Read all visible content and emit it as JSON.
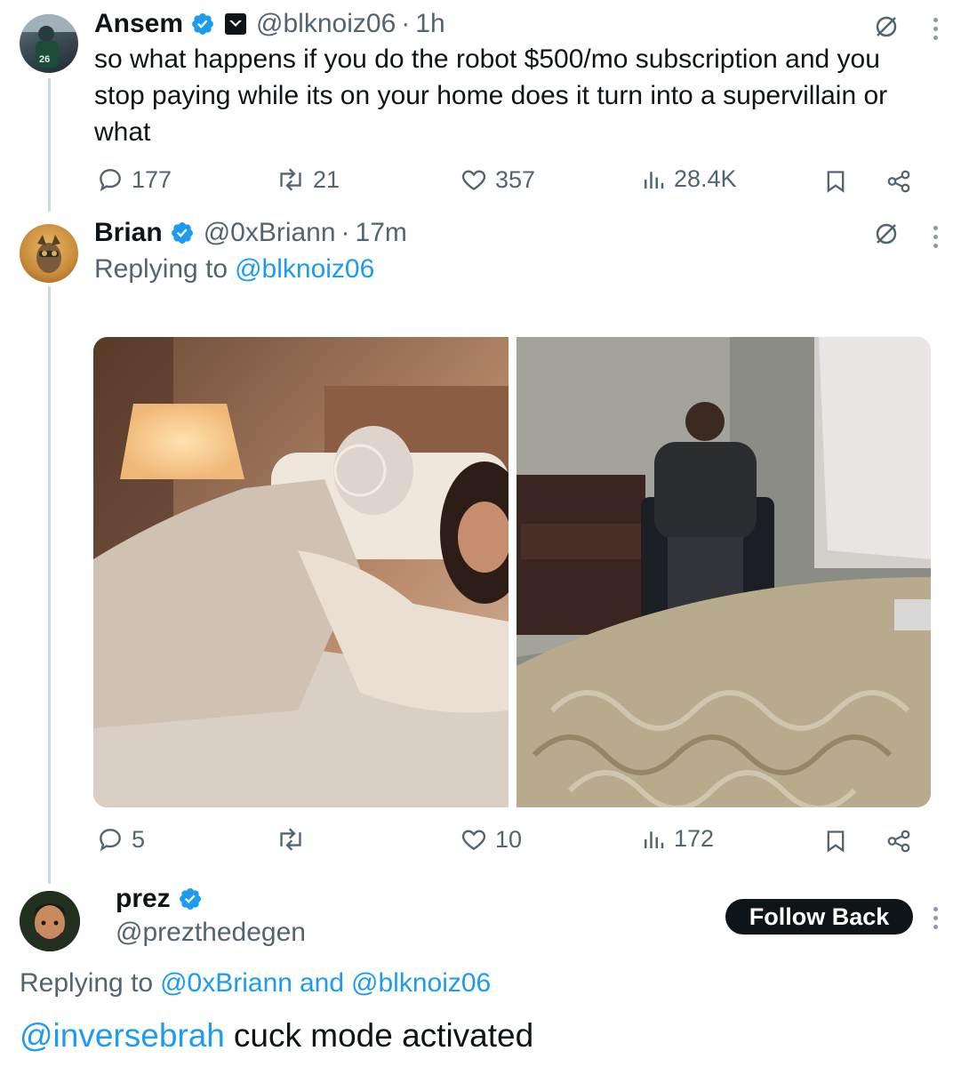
{
  "tweet1": {
    "name": "Ansem",
    "handle": "@blknoiz06",
    "time": "1h",
    "text": "so what happens if you do the robot $500/mo subscription and you stop paying while its on your home does it turn into a supervillain or what",
    "stats": {
      "replies": "177",
      "retweets": "21",
      "likes": "357",
      "views": "28.4K"
    }
  },
  "tweet2": {
    "name": "Brian",
    "handle": "@0xBriann",
    "time": "17m",
    "replying_prefix": "Replying to",
    "replying_to": "@blknoiz06",
    "images": [
      {
        "icon": "photo-robot-bedroom"
      },
      {
        "icon": "photo-man-in-chair-hotel-room"
      }
    ],
    "stats": {
      "replies": "5",
      "retweets": "",
      "likes": "10",
      "views": "172"
    }
  },
  "tweet3": {
    "name": "prez",
    "handle": "@prezthedegen",
    "follow_label": "Follow Back",
    "replying_prefix": "Replying to",
    "replying_to_1": "@0xBriann",
    "replying_and": "and",
    "replying_to_2": "@blknoiz06",
    "mention": "@inversebrah",
    "text": "cuck mode activated"
  },
  "colors": {
    "accent": "#1d9bf0",
    "muted": "#536471",
    "text": "#0f1419"
  }
}
